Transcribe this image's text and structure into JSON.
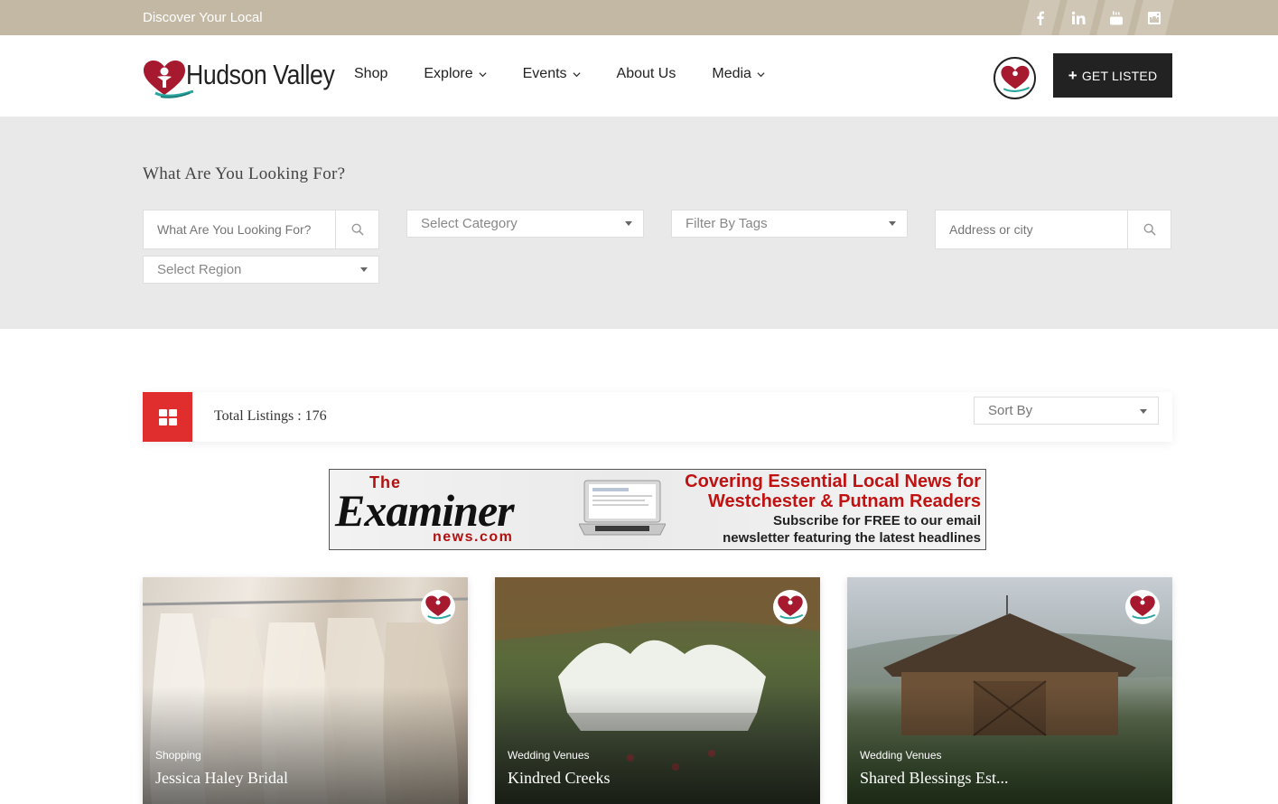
{
  "topbar": {
    "tagline": "Discover Your Local",
    "social": [
      "facebook-icon",
      "linkedin-icon",
      "youtube-icon",
      "instagram-icon"
    ]
  },
  "header": {
    "logo_text": "Hudson Valley",
    "nav": [
      {
        "label": "Shop",
        "dropdown": false
      },
      {
        "label": "Explore",
        "dropdown": true
      },
      {
        "label": "Events",
        "dropdown": true
      },
      {
        "label": "About Us",
        "dropdown": false
      },
      {
        "label": "Media",
        "dropdown": true
      }
    ],
    "cta_label": "GET LISTED"
  },
  "search": {
    "title": "What Are You Looking For?",
    "keyword_placeholder": "What Are You Looking For?",
    "category_label": "Select Category",
    "tags_label": "Filter By Tags",
    "address_placeholder": "Address or city",
    "region_label": "Select Region"
  },
  "listings": {
    "total_label": "Total Listings : 176",
    "sort_label": "Sort By"
  },
  "ad": {
    "the": "The",
    "brand": "Examiner",
    "domain": "news.com",
    "headline_line1": "Covering Essential Local News for",
    "headline_line2": "Westchester & Putnam Readers",
    "sub_line1": "Subscribe for FREE to our email",
    "sub_line2": "newsletter featuring the latest headlines"
  },
  "cards": [
    {
      "category": "Shopping",
      "name": "Jessica Haley Bridal"
    },
    {
      "category": "Wedding Venues",
      "name": "Kindred Creeks"
    },
    {
      "category": "Wedding Venues",
      "name": "Shared Blessings Est..."
    }
  ],
  "colors": {
    "topbar": "#c3b8a3",
    "accent_red": "#e02e2e",
    "cta_dark": "#222222",
    "search_bg": "#e9e9e9"
  }
}
